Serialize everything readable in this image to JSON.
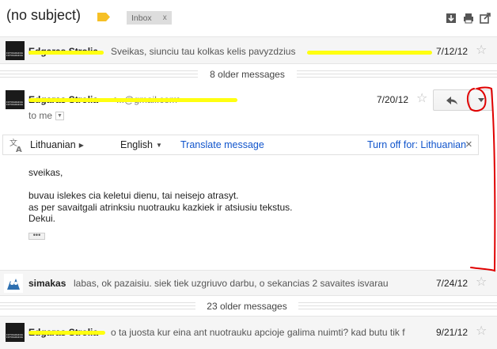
{
  "header": {
    "subject": "(no subject)",
    "label_chip": "Inbox",
    "label_chip_close": "x",
    "icons": [
      "download-icon",
      "print-icon",
      "new-window-icon"
    ]
  },
  "messages": [
    {
      "sender": "Edgaras Strolia",
      "snippet": "Sveikas, siunciu tau kolkas kelis pavyzdzius",
      "date": "7/12/12",
      "avatar_text": "FOTOGRAFIJA FOTOGRAFIJA"
    },
    {
      "older_count": "8 older messages"
    },
    {
      "sender": "Edgaras Strolia",
      "sender_email": "<...@gmail.com>",
      "date": "7/20/12",
      "to": "to me",
      "translate": {
        "from": "Lithuanian",
        "to": "English",
        "action": "Translate message",
        "turn_off": "Turn off for: Lithuanian",
        "close": "×"
      },
      "body": [
        "sveikas,",
        "",
        "buvau islekes cia keletui dienu, tai neisejo atrasyt.",
        "as per savaitgali atrinksiu nuotrauku kazkiek ir atsiusiu tekstus.",
        "Dekui."
      ],
      "ellipsis": "•••"
    },
    {
      "sender": "simakas",
      "snippet": "labas, ok pazaisiu. siek tiek uzgriuvo darbu, o sekancias 2 savaites isvarau",
      "date": "7/24/12"
    },
    {
      "older_count": "23 older messages"
    },
    {
      "sender": "Edgaras Strolia",
      "snippet": "o ta juosta kur eina ant nuotrauku apcioje galima nuimti? kad butu tik f",
      "date": "9/21/12"
    }
  ],
  "colors": {
    "highlight": "#ffff10",
    "annotation": "#e00000",
    "link": "#1155cc",
    "label_tag": "#f6c026"
  }
}
